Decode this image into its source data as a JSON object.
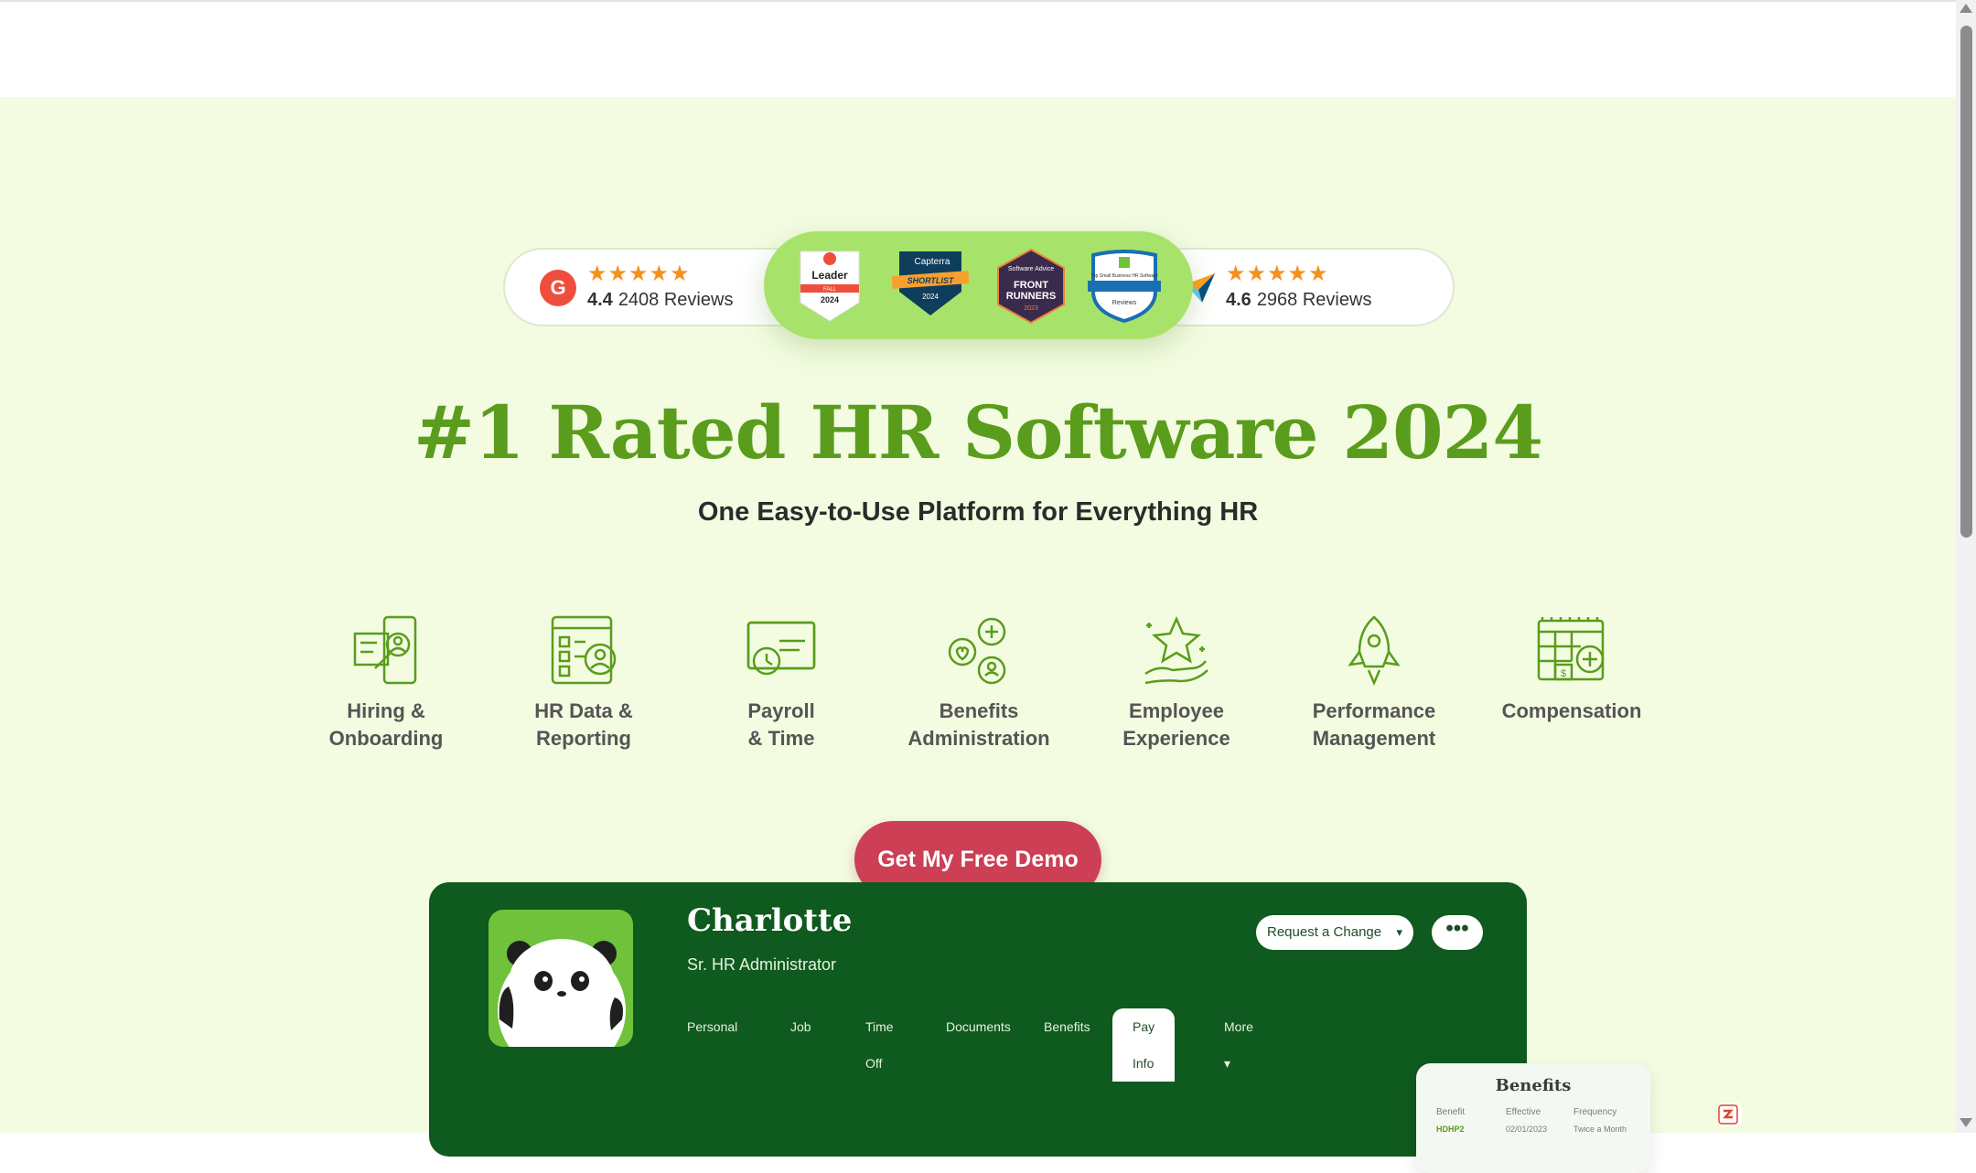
{
  "reviews": {
    "g2": {
      "logo_text": "G",
      "score": "4.4",
      "count": "2408 Reviews",
      "stars": "★★★★★"
    },
    "capterra": {
      "score": "4.6",
      "count": "2968 Reviews",
      "stars": "★★★★★"
    }
  },
  "badges": [
    {
      "name": "g2-leader-badge",
      "lines": [
        "Leader",
        "FALL",
        "2024"
      ]
    },
    {
      "name": "capterra-shortlist-badge",
      "lines": [
        "Capterra",
        "SHORTLIST",
        "2024"
      ]
    },
    {
      "name": "software-advice-frontrunners-badge",
      "lines": [
        "Software Advice",
        "FRONT",
        "RUNNERS",
        "2023"
      ]
    },
    {
      "name": "small-business-hr-badge",
      "lines": [
        "Top Small Business HR Software",
        "Reviews"
      ]
    }
  ],
  "hero": {
    "title": "#1 Rated HR Software 2024",
    "subtitle": "One Easy-to-Use Platform for Everything HR",
    "cta_label": "Get My Free Demo"
  },
  "features": [
    {
      "label": "Hiring &\nOnboarding",
      "icon": "hiring-icon"
    },
    {
      "label": "HR Data &\nReporting",
      "icon": "hr-data-icon"
    },
    {
      "label": "Payroll\n& Time",
      "icon": "payroll-icon"
    },
    {
      "label": "Benefits\nAdministration",
      "icon": "benefits-icon"
    },
    {
      "label": "Employee\nExperience",
      "icon": "employee-experience-icon"
    },
    {
      "label": "Performance\nManagement",
      "icon": "performance-icon"
    },
    {
      "label": "Compensation",
      "icon": "compensation-icon"
    }
  ],
  "preview": {
    "name": "Charlotte",
    "role": "Sr. HR Administrator",
    "request_change_label": "Request a Change",
    "more_dots": "•••",
    "tabs": [
      "Personal",
      "Job",
      "Time Off",
      "Documents",
      "Benefits",
      "Pay Info",
      "More ▾"
    ],
    "active_tab": "Pay Info",
    "benefits_card": {
      "title": "Benefits",
      "columns": [
        "Benefit",
        "Effective",
        "Frequency"
      ],
      "row": [
        "HDHP2",
        "02/01/2023",
        "Twice a Month"
      ]
    }
  },
  "colors": {
    "hero_bg": "#f3fce1",
    "brand_green": "#5a9c1c",
    "cta_red": "#cc3f54",
    "app_dark_green": "#0f5a1e"
  }
}
